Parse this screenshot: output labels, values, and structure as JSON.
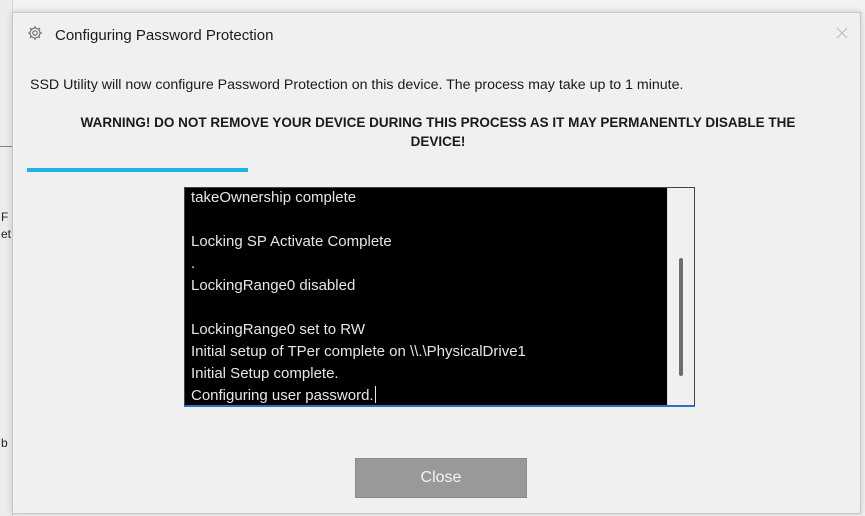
{
  "background": {
    "fragments": [
      "F",
      "et",
      "b"
    ]
  },
  "dialog": {
    "title": "Configuring Password Protection",
    "title_icon": "gear-icon",
    "close_icon": "close-icon",
    "info": "SSD Utility will now configure Password Protection on this device. The process may take up to 1 minute.",
    "warning": "WARNING! DO NOT REMOVE YOUR DEVICE DURING THIS PROCESS AS IT MAY PERMANENTLY DISABLE THE DEVICE!",
    "progress_fraction": 0.27,
    "accent_color": "#1fb5e0",
    "console": {
      "lines": [
        "takeOwnership complete",
        "",
        "Locking SP Activate Complete",
        ".",
        "LockingRange0 disabled",
        "",
        "LockingRange0 set to RW",
        "Initial setup of TPer complete on \\\\.\\PhysicalDrive1",
        "Initial Setup complete.",
        "Configuring user password."
      ]
    },
    "close_button_label": "Close"
  }
}
